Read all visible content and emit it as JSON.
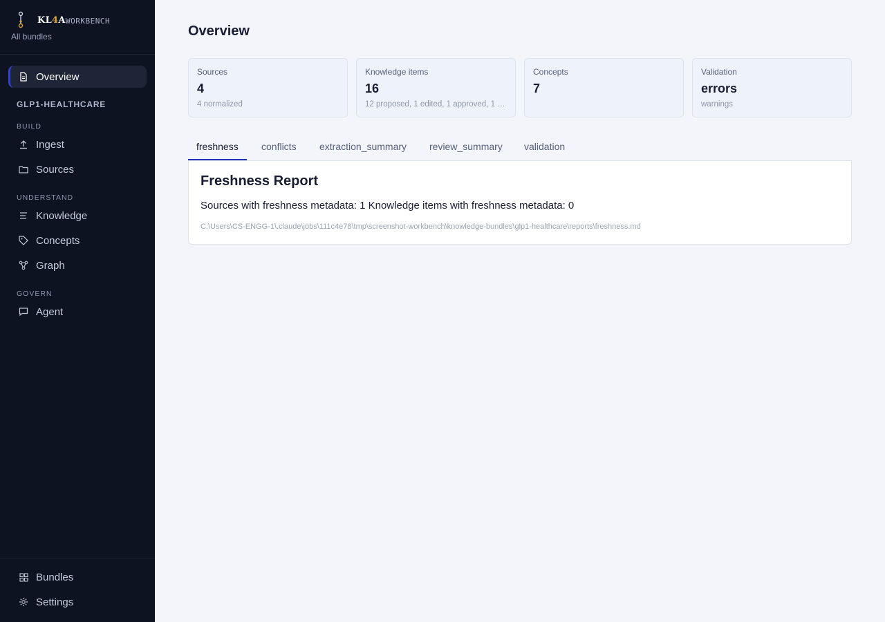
{
  "brand": {
    "name_prefix": "KL",
    "name_highlight": "4",
    "name_suffix": "A",
    "subtitle": "WORKBENCH",
    "all_bundles": "All bundles"
  },
  "sidebar": {
    "overview": "Overview",
    "bundle": "GLP1-HEALTHCARE",
    "build_heading": "BUILD",
    "ingest": "Ingest",
    "sources": "Sources",
    "understand_heading": "UNDERSTAND",
    "knowledge": "Knowledge",
    "concepts": "Concepts",
    "graph": "Graph",
    "govern_heading": "GOVERN",
    "agent": "Agent",
    "bundles": "Bundles",
    "settings": "Settings"
  },
  "page": {
    "title": "Overview"
  },
  "cards": [
    {
      "label": "Sources",
      "value": "4",
      "sub": "4 normalized"
    },
    {
      "label": "Knowledge items",
      "value": "16",
      "sub": "12 proposed, 1 edited, 1 approved, 1 …"
    },
    {
      "label": "Concepts",
      "value": "7",
      "sub": ""
    },
    {
      "label": "Validation",
      "value": "errors",
      "sub": "warnings"
    }
  ],
  "tabs": [
    "freshness",
    "conflicts",
    "extraction_summary",
    "review_summary",
    "validation"
  ],
  "report": {
    "title": "Freshness Report",
    "body": "Sources with freshness metadata: 1 Knowledge items with freshness metadata: 0",
    "path": "C:\\Users\\CS-ENGG-1\\.claude\\jobs\\111c4e78\\tmp\\screenshot-workbench\\knowledge-bundles\\glp1-healthcare\\reports\\freshness.md"
  },
  "colors": {
    "sidebar_bg": "#0d1321",
    "accent": "#1f2fb8",
    "brand_highlight": "#d9a441"
  }
}
